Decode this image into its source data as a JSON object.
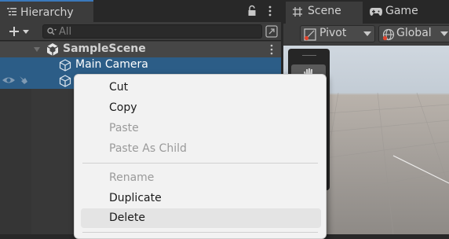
{
  "hierarchy": {
    "tab_label": "Hierarchy",
    "search_placeholder": "All",
    "scene_name": "SampleScene",
    "items": [
      {
        "label": "Main Camera"
      }
    ]
  },
  "scene_panel": {
    "tabs": [
      {
        "label": "Scene"
      },
      {
        "label": "Game"
      }
    ],
    "pivot_label": "Pivot",
    "global_label": "Global"
  },
  "context_menu": {
    "items": [
      {
        "label": "Cut",
        "enabled": true
      },
      {
        "label": "Copy",
        "enabled": true
      },
      {
        "label": "Paste",
        "enabled": false
      },
      {
        "label": "Paste As Child",
        "enabled": false
      },
      {
        "label": "Rename",
        "enabled": false
      },
      {
        "label": "Duplicate",
        "enabled": true
      },
      {
        "label": "Delete",
        "enabled": true,
        "highlighted": true
      }
    ]
  },
  "colors": {
    "selection": "#2c5d87",
    "accent": "#3a79bb",
    "menu_bg": "#f2f2f2"
  }
}
